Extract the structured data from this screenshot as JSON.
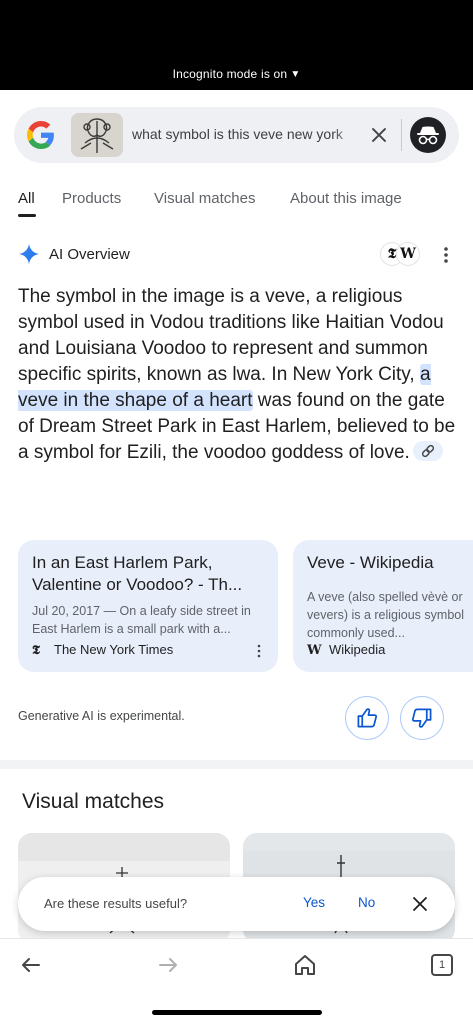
{
  "status": {
    "incognito_label": "Incognito mode is on"
  },
  "search": {
    "query": "what symbol is this veve new york"
  },
  "tabs": [
    {
      "label": "All"
    },
    {
      "label": "Products"
    },
    {
      "label": "Visual matches"
    },
    {
      "label": "About this image"
    }
  ],
  "ai_overview": {
    "title": "AI Overview",
    "source_icons": [
      "𝕿",
      "W"
    ],
    "text_before": "The symbol in the image is a veve, a religious symbol used in Vodou traditions like Haitian Vodou and Louisiana Voodoo to represent and summon specific spirits, known as lwa. In New York City, ",
    "text_highlight": "a veve in the shape of a heart",
    "text_after": " was found on the gate of Dream Street Park in East Harlem, believed to be a symbol for Ezili, the voodoo goddess of love."
  },
  "source_cards": [
    {
      "title": "In an East Harlem Park, Valentine or Voodoo? - Th...",
      "snippet": "Jul 20, 2017 — On a leafy side street in East Harlem is a small park with a...",
      "source": "The New York Times",
      "fav": "𝕿"
    },
    {
      "title": "Veve - Wikipedia",
      "snippet": "A veve (also spelled vèvè or vevers) is a religious symbol commonly used...",
      "source": "Wikipedia",
      "fav": "W"
    }
  ],
  "gen_ai_note": "Generative AI is experimental.",
  "visual_matches": {
    "title": "Visual matches"
  },
  "feedback_toast": {
    "question": "Are these results useful?",
    "yes": "Yes",
    "no": "No"
  },
  "bottom_nav": {
    "tab_count": "1"
  },
  "colors": {
    "accent": "#0b57d0",
    "highlight": "#d3e3fd",
    "card_bg": "#e9eefb"
  }
}
